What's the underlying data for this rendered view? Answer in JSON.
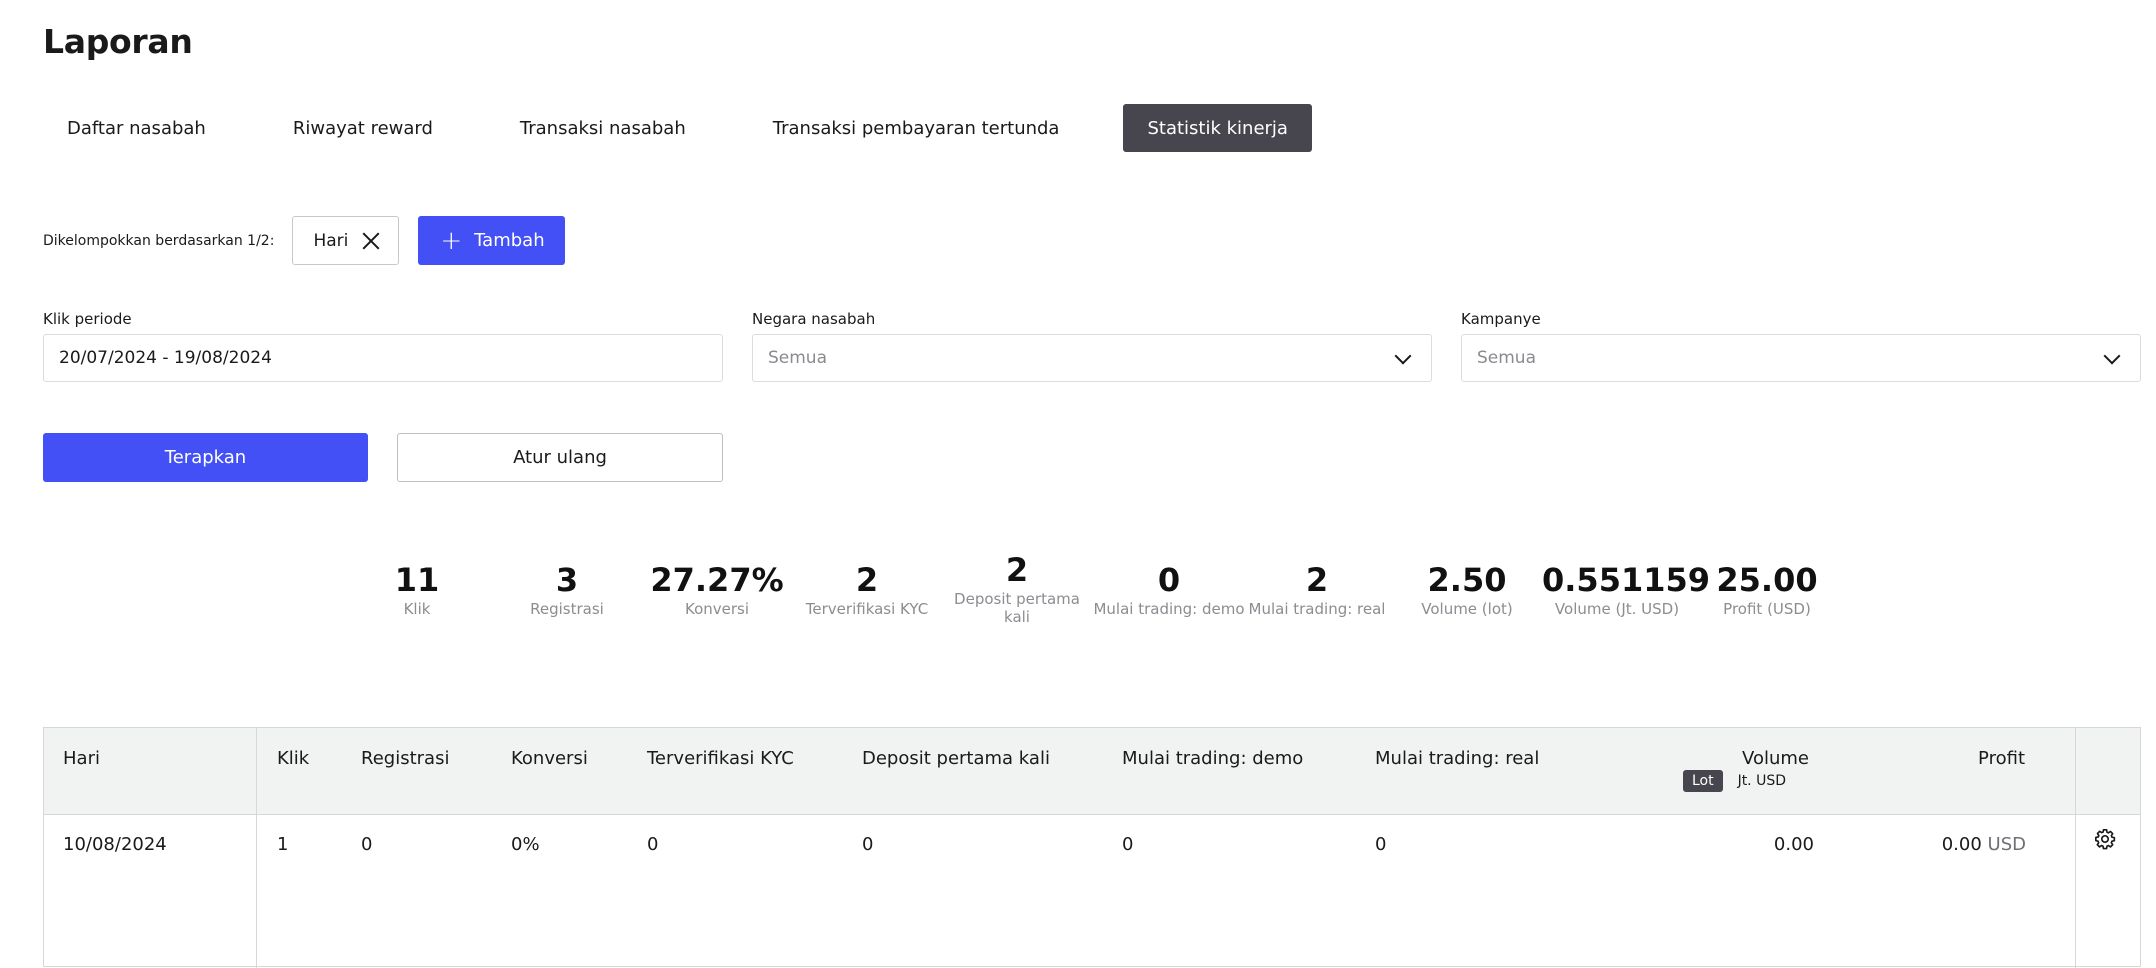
{
  "page": {
    "title": "Laporan"
  },
  "tabs": [
    {
      "label": "Daftar nasabah"
    },
    {
      "label": "Riwayat reward"
    },
    {
      "label": "Transaksi nasabah"
    },
    {
      "label": "Transaksi pembayaran tertunda"
    },
    {
      "label": "Statistik kinerja",
      "active": true
    }
  ],
  "groupby": {
    "label": "Dikelompokkan berdasarkan 1/2:",
    "chip": "Hari",
    "add_label": "Tambah"
  },
  "filters": {
    "period": {
      "label": "Klik periode",
      "value": "20/07/2024 - 19/08/2024"
    },
    "country": {
      "label": "Negara nasabah",
      "placeholder": "Semua"
    },
    "campaign": {
      "label": "Kampanye",
      "placeholder": "Semua"
    }
  },
  "actions": {
    "apply": "Terapkan",
    "reset": "Atur ulang"
  },
  "stats": [
    {
      "value": "11",
      "label": "Klik"
    },
    {
      "value": "3",
      "label": "Registrasi"
    },
    {
      "value": "27.27%",
      "label": "Konversi"
    },
    {
      "value": "2",
      "label": "Terverifikasi KYC"
    },
    {
      "value": "2",
      "label": "Deposit pertama kali"
    },
    {
      "value": "0",
      "label": "Mulai trading: demo"
    },
    {
      "value": "2",
      "label": "Mulai trading: real"
    },
    {
      "value": "2.50",
      "label": "Volume (lot)"
    },
    {
      "value": "0.551159",
      "label": "Volume (Jt. USD)"
    },
    {
      "value": "25.00",
      "label": "Profit (USD)"
    }
  ],
  "table": {
    "headers": {
      "day": "Hari",
      "clicks": "Klik",
      "registrations": "Registrasi",
      "conversion": "Konversi",
      "kyc": "Terverifikasi KYC",
      "first_deposit": "Deposit pertama kali",
      "trading_demo": "Mulai trading: demo",
      "trading_real": "Mulai trading: real",
      "volume": "Volume",
      "profit": "Profit"
    },
    "volume_units": {
      "lot": "Lot",
      "usd": "Jt. USD",
      "active": "lot"
    },
    "rows": [
      {
        "day": "10/08/2024",
        "clicks": "1",
        "registrations": "0",
        "conversion": "0%",
        "kyc": "0",
        "first_deposit": "0",
        "trading_demo": "0",
        "trading_real": "0",
        "volume": "0.00",
        "profit": "0.00",
        "profit_unit": "USD"
      }
    ]
  },
  "colors": {
    "accent": "#4250f5",
    "active_tab": "#47464e",
    "header_bg": "#f1f2f2"
  }
}
